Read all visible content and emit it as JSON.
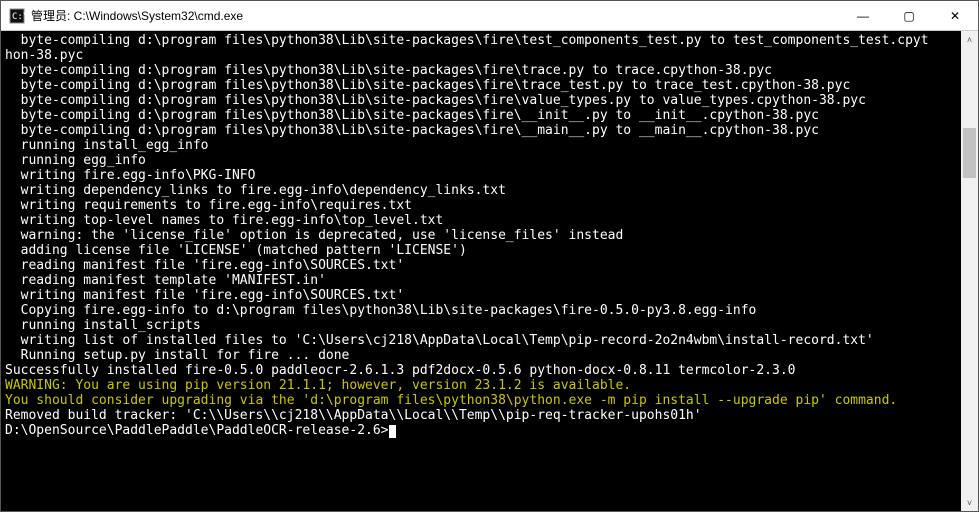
{
  "window": {
    "title": "管理员: C:\\Windows\\System32\\cmd.exe",
    "min_label": "—",
    "max_label": "▢",
    "close_label": "✕"
  },
  "scrollbar": {
    "up": "˄",
    "down": "˅"
  },
  "terminal": {
    "lines": [
      {
        "text": "  byte-compiling d:\\program files\\python38\\Lib\\site-packages\\fire\\test_components_test.py to test_components_test.cpyt",
        "cls": ""
      },
      {
        "text": "hon-38.pyc",
        "cls": ""
      },
      {
        "text": "  byte-compiling d:\\program files\\python38\\Lib\\site-packages\\fire\\trace.py to trace.cpython-38.pyc",
        "cls": ""
      },
      {
        "text": "  byte-compiling d:\\program files\\python38\\Lib\\site-packages\\fire\\trace_test.py to trace_test.cpython-38.pyc",
        "cls": ""
      },
      {
        "text": "  byte-compiling d:\\program files\\python38\\Lib\\site-packages\\fire\\value_types.py to value_types.cpython-38.pyc",
        "cls": ""
      },
      {
        "text": "  byte-compiling d:\\program files\\python38\\Lib\\site-packages\\fire\\__init__.py to __init__.cpython-38.pyc",
        "cls": ""
      },
      {
        "text": "  byte-compiling d:\\program files\\python38\\Lib\\site-packages\\fire\\__main__.py to __main__.cpython-38.pyc",
        "cls": ""
      },
      {
        "text": "  running install_egg_info",
        "cls": ""
      },
      {
        "text": "  running egg_info",
        "cls": ""
      },
      {
        "text": "  writing fire.egg-info\\PKG-INFO",
        "cls": ""
      },
      {
        "text": "  writing dependency_links to fire.egg-info\\dependency_links.txt",
        "cls": ""
      },
      {
        "text": "  writing requirements to fire.egg-info\\requires.txt",
        "cls": ""
      },
      {
        "text": "  writing top-level names to fire.egg-info\\top_level.txt",
        "cls": ""
      },
      {
        "text": "  warning: the 'license_file' option is deprecated, use 'license_files' instead",
        "cls": ""
      },
      {
        "text": "  adding license file 'LICENSE' (matched pattern 'LICENSE')",
        "cls": ""
      },
      {
        "text": "  reading manifest file 'fire.egg-info\\SOURCES.txt'",
        "cls": ""
      },
      {
        "text": "  reading manifest template 'MANIFEST.in'",
        "cls": ""
      },
      {
        "text": "  writing manifest file 'fire.egg-info\\SOURCES.txt'",
        "cls": ""
      },
      {
        "text": "  Copying fire.egg-info to d:\\program files\\python38\\Lib\\site-packages\\fire-0.5.0-py3.8.egg-info",
        "cls": ""
      },
      {
        "text": "  running install_scripts",
        "cls": ""
      },
      {
        "text": "  writing list of installed files to 'C:\\Users\\cj218\\AppData\\Local\\Temp\\pip-record-2o2n4wbm\\install-record.txt'",
        "cls": ""
      },
      {
        "text": "  Running setup.py install for fire ... done",
        "cls": ""
      },
      {
        "text": "",
        "cls": ""
      },
      {
        "text": "Successfully installed fire-0.5.0 paddleocr-2.6.1.3 pdf2docx-0.5.6 python-docx-0.8.11 termcolor-2.3.0",
        "cls": ""
      },
      {
        "text": "WARNING: You are using pip version 21.1.1; however, version 23.1.2 is available.",
        "cls": "yellow"
      },
      {
        "text": "You should consider upgrading via the 'd:\\program files\\python38\\python.exe -m pip install --upgrade pip' command.",
        "cls": "yellow"
      },
      {
        "text": "Removed build tracker: 'C:\\\\Users\\\\cj218\\\\AppData\\\\Local\\\\Temp\\\\pip-req-tracker-upohs01h'",
        "cls": ""
      },
      {
        "text": "",
        "cls": ""
      }
    ],
    "prompt": "D:\\OpenSource\\PaddlePaddle\\PaddleOCR-release-2.6>"
  }
}
